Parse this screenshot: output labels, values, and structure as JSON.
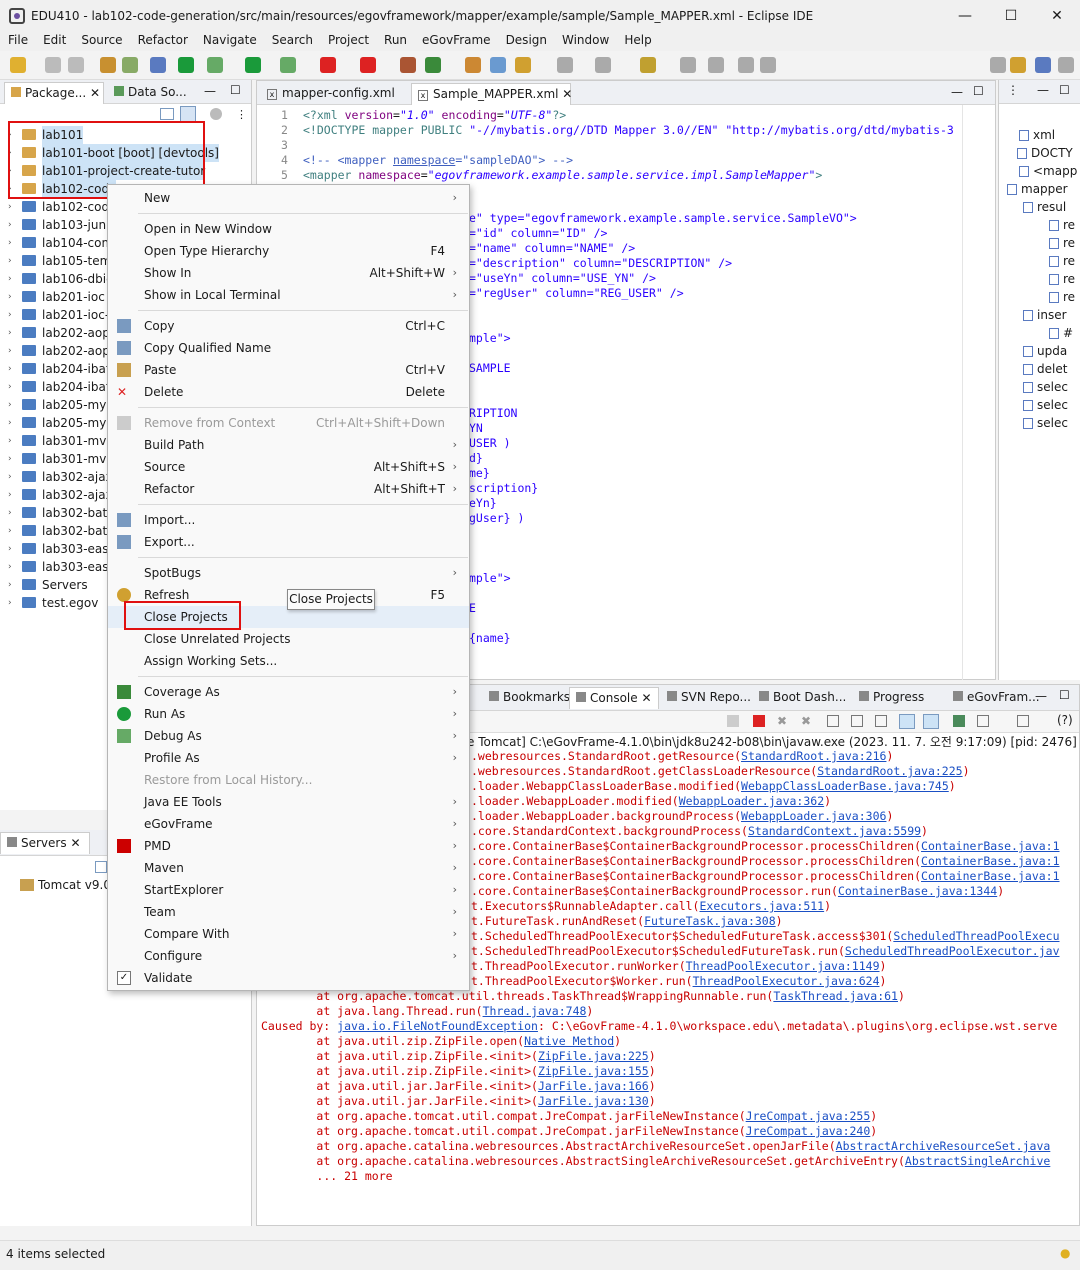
{
  "window": {
    "title": "EDU410 - lab102-code-generation/src/main/resources/egovframework/mapper/example/sample/Sample_MAPPER.xml - Eclipse IDE",
    "minimize": "—",
    "maximize": "☐",
    "close": "✕"
  },
  "menubar": [
    "File",
    "Edit",
    "Source",
    "Refactor",
    "Navigate",
    "Search",
    "Project",
    "Run",
    "eGovFrame",
    "Design",
    "Window",
    "Help"
  ],
  "left_panel": {
    "tabs": [
      "Package...",
      "Data So..."
    ],
    "tree": [
      {
        "label": "lab101",
        "selected": true
      },
      {
        "label": "lab101-boot [boot] [devtools]",
        "selected": true
      },
      {
        "label": "lab101-project-create-tutor",
        "selected": true
      },
      {
        "label": "lab102-code",
        "selected": true
      },
      {
        "label": "lab102-code"
      },
      {
        "label": "lab103-junit"
      },
      {
        "label": "lab104-com"
      },
      {
        "label": "lab105-tem"
      },
      {
        "label": "lab106-dbic"
      },
      {
        "label": "lab201-ioc"
      },
      {
        "label": "lab201-ioc-"
      },
      {
        "label": "lab202-aop"
      },
      {
        "label": "lab202-aop-"
      },
      {
        "label": "lab204-ibati"
      },
      {
        "label": "lab204-ibati"
      },
      {
        "label": "lab205-myb"
      },
      {
        "label": "lab205-myb"
      },
      {
        "label": "lab301-mvc"
      },
      {
        "label": "lab301-mvc"
      },
      {
        "label": "lab302-ajax"
      },
      {
        "label": "lab302-ajax"
      },
      {
        "label": "lab302-batc"
      },
      {
        "label": "lab302-batc"
      },
      {
        "label": "lab303-easy"
      },
      {
        "label": "lab303-easy"
      },
      {
        "label": "Servers"
      },
      {
        "label": "test.egov"
      }
    ]
  },
  "servers_panel": {
    "tab": "Servers",
    "item": "Tomcat v9.0"
  },
  "editor": {
    "tabs": [
      "mapper-config.xml",
      "Sample_MAPPER.xml"
    ],
    "lines": [
      {
        "n": "1",
        "html": "<span class='tag'>&lt;?xml</span> <span class='attr'>version</span>=<span class='str'>\"1.0\"</span> <span class='attr'>encoding</span>=<span class='str'>\"UTF-8\"</span><span class='tag'>?&gt;</span>"
      },
      {
        "n": "2",
        "html": "<span class='tag'>&lt;!DOCTYPE mapper PUBLIC</span> <span class='str' style='font-style:normal'>\"-//mybatis.org//DTD Mapper 3.0//EN\" \"http://mybatis.org/dtd/mybatis-3</span>"
      },
      {
        "n": "3",
        "html": ""
      },
      {
        "n": "4",
        "html": "<span class='cmt'>&lt;!-- &lt;mapper <u>namespace</u>=\"sampleDAO\"&gt; --&gt;</span>"
      },
      {
        "n": "5",
        "html": "<span class='tag'>&lt;mapper</span> <span class='attr'>namespace</span>=<span class='str'>\"egovframework.example.sample.service.impl.SampleMapper\"</span><span class='tag'>&gt;</span>"
      }
    ],
    "partial_lines": [
      "e\" type=\"egovframework.example.sample.service.SampleVO\">",
      "=\"id\" column=\"ID\" />",
      "=\"name\" column=\"NAME\" />",
      "=\"description\" column=\"DESCRIPTION\" />",
      "=\"useYn\" column=\"USE_YN\" />",
      "=\"regUser\" column=\"REG_USER\" />",
      "",
      "",
      "mple\">",
      "",
      "SAMPLE",
      "",
      "",
      "RIPTION",
      "YN",
      "USER )",
      "d}",
      "me}",
      "scription}",
      "eYn}",
      "gUser} )",
      "",
      "",
      "",
      "mple\">",
      "",
      "E",
      "",
      "{name}"
    ]
  },
  "outline": {
    "items": [
      "xml",
      "DOCTY",
      "<mapp",
      "mapper",
      "resul",
      "re",
      "re",
      "re",
      "re",
      "re",
      "inser",
      "#",
      "upda",
      "delet",
      "selec",
      "selec",
      "selec"
    ]
  },
  "console": {
    "tabs": [
      "Bookmarks",
      "Console",
      "SVN Repo...",
      "Boot Dash...",
      "Progress",
      "eGovFram..."
    ],
    "header": "e Tomcat] C:\\eGovFrame-4.1.0\\bin\\jdk8u242-b08\\bin\\javaw.exe  (2023. 11. 7. 오전 9:17:09) [pid: 2476]",
    "lines": [
      [
        "",
        ".webresources.StandardRoot.getResource(",
        "StandardRoot.java:216",
        ")"
      ],
      [
        "",
        ".webresources.StandardRoot.getClassLoaderResource(",
        "StandardRoot.java:225",
        ")"
      ],
      [
        "",
        ".loader.WebappClassLoaderBase.modified(",
        "WebappClassLoaderBase.java:745",
        ")"
      ],
      [
        "",
        ".loader.WebappLoader.modified(",
        "WebappLoader.java:362",
        ")"
      ],
      [
        "",
        ".loader.WebappLoader.backgroundProcess(",
        "WebappLoader.java:306",
        ")"
      ],
      [
        "",
        ".core.StandardContext.backgroundProcess(",
        "StandardContext.java:5599",
        ")"
      ],
      [
        "",
        ".core.ContainerBase$ContainerBackgroundProcessor.processChildren(",
        "ContainerBase.java:1",
        ""
      ],
      [
        "",
        ".core.ContainerBase$ContainerBackgroundProcessor.processChildren(",
        "ContainerBase.java:1",
        ""
      ],
      [
        "",
        ".core.ContainerBase$ContainerBackgroundProcessor.processChildren(",
        "ContainerBase.java:1",
        ""
      ],
      [
        "",
        ".core.ContainerBase$ContainerBackgroundProcessor.run(",
        "ContainerBase.java:1344",
        ")"
      ],
      [
        "",
        "t.Executors$RunnableAdapter.call(",
        "Executors.java:511",
        ")"
      ],
      [
        "",
        "t.FutureTask.runAndReset(",
        "FutureTask.java:308",
        ")"
      ],
      [
        "",
        "t.ScheduledThreadPoolExecutor$ScheduledFutureTask.access$301(",
        "ScheduledThreadPoolExecu",
        ""
      ],
      [
        "",
        "t.ScheduledThreadPoolExecutor$ScheduledFutureTask.run(",
        "ScheduledThreadPoolExecutor.jav",
        ""
      ],
      [
        "",
        "t.ThreadPoolExecutor.runWorker(",
        "ThreadPoolExecutor.java:1149",
        ")"
      ],
      [
        "",
        "t.ThreadPoolExecutor$Worker.run(",
        "ThreadPoolExecutor.java:624",
        ")"
      ],
      [
        "        ",
        "at org.apache.tomcat.util.threads.TaskThread$WrappingRunnable.run(",
        "TaskThread.java:61",
        ")"
      ],
      [
        "        ",
        "at java.lang.Thread.run(",
        "Thread.java:748",
        ")"
      ],
      [
        "",
        "Caused by: ",
        "java.io.FileNotFoundException",
        ": C:\\eGovFrame-4.1.0\\workspace.edu\\.metadata\\.plugins\\org.eclipse.wst.serve"
      ],
      [
        "        ",
        "at java.util.zip.ZipFile.open(",
        "Native Method",
        ")"
      ],
      [
        "        ",
        "at java.util.zip.ZipFile.<init>(",
        "ZipFile.java:225",
        ")"
      ],
      [
        "        ",
        "at java.util.zip.ZipFile.<init>(",
        "ZipFile.java:155",
        ")"
      ],
      [
        "        ",
        "at java.util.jar.JarFile.<init>(",
        "JarFile.java:166",
        ")"
      ],
      [
        "        ",
        "at java.util.jar.JarFile.<init>(",
        "JarFile.java:130",
        ")"
      ],
      [
        "        ",
        "at org.apache.tomcat.util.compat.JreCompat.jarFileNewInstance(",
        "JreCompat.java:255",
        ")"
      ],
      [
        "        ",
        "at org.apache.tomcat.util.compat.JreCompat.jarFileNewInstance(",
        "JreCompat.java:240",
        ")"
      ],
      [
        "        ",
        "at org.apache.catalina.webresources.AbstractArchiveResourceSet.openJarFile(",
        "AbstractArchiveResourceSet.java",
        ""
      ],
      [
        "        ",
        "at org.apache.catalina.webresources.AbstractSingleArchiveResourceSet.getArchiveEntry(",
        "AbstractSingleArchive",
        ""
      ],
      [
        "        ",
        "... 21 more",
        "",
        ""
      ]
    ]
  },
  "context_menu": {
    "items": [
      {
        "label": "New",
        "shortcut": "",
        "arrow": true,
        "icon": ""
      },
      {
        "sep": true
      },
      {
        "label": "Open in New Window",
        "shortcut": "",
        "arrow": false
      },
      {
        "label": "Open Type Hierarchy",
        "shortcut": "F4",
        "arrow": false
      },
      {
        "label": "Show In",
        "shortcut": "Alt+Shift+W",
        "arrow": true
      },
      {
        "label": "Show in Local Terminal",
        "shortcut": "",
        "arrow": true
      },
      {
        "sep": true
      },
      {
        "label": "Copy",
        "shortcut": "Ctrl+C",
        "icon": "copy-icon"
      },
      {
        "label": "Copy Qualified Name",
        "shortcut": "",
        "icon": "copy-qualified-icon"
      },
      {
        "label": "Paste",
        "shortcut": "Ctrl+V",
        "icon": "paste-icon"
      },
      {
        "label": "Delete",
        "shortcut": "Delete",
        "icon": "delete-icon"
      },
      {
        "sep": true
      },
      {
        "label": "Remove from Context",
        "shortcut": "Ctrl+Alt+Shift+Down",
        "disabled": true,
        "icon": "remove-context-icon"
      },
      {
        "label": "Build Path",
        "shortcut": "",
        "arrow": true
      },
      {
        "label": "Source",
        "shortcut": "Alt+Shift+S",
        "arrow": true
      },
      {
        "label": "Refactor",
        "shortcut": "Alt+Shift+T",
        "arrow": true
      },
      {
        "sep": true
      },
      {
        "label": "Import...",
        "shortcut": "",
        "icon": "import-icon"
      },
      {
        "label": "Export...",
        "shortcut": "",
        "icon": "export-icon"
      },
      {
        "sep": true
      },
      {
        "label": "SpotBugs",
        "shortcut": "",
        "arrow": true
      },
      {
        "label": "Refresh",
        "shortcut": "F5",
        "icon": "refresh-icon"
      },
      {
        "label": "Close Projects",
        "shortcut": "",
        "highlight": true
      },
      {
        "label": "Close Unrelated Projects",
        "shortcut": ""
      },
      {
        "label": "Assign Working Sets...",
        "shortcut": ""
      },
      {
        "sep": true
      },
      {
        "label": "Coverage As",
        "shortcut": "",
        "arrow": true,
        "icon": "coverage-icon"
      },
      {
        "label": "Run As",
        "shortcut": "",
        "arrow": true,
        "icon": "run-icon"
      },
      {
        "label": "Debug As",
        "shortcut": "",
        "arrow": true,
        "icon": "debug-icon"
      },
      {
        "label": "Profile As",
        "shortcut": "",
        "arrow": true
      },
      {
        "label": "Restore from Local History...",
        "shortcut": "",
        "disabled": true
      },
      {
        "label": "Java EE Tools",
        "shortcut": "",
        "arrow": true
      },
      {
        "label": "eGovFrame",
        "shortcut": "",
        "arrow": true
      },
      {
        "label": "PMD",
        "shortcut": "",
        "arrow": true,
        "icon": "pmd-icon"
      },
      {
        "label": "Maven",
        "shortcut": "",
        "arrow": true
      },
      {
        "label": "StartExplorer",
        "shortcut": "",
        "arrow": true
      },
      {
        "label": "Team",
        "shortcut": "",
        "arrow": true
      },
      {
        "label": "Compare With",
        "shortcut": "",
        "arrow": true
      },
      {
        "label": "Configure",
        "shortcut": "",
        "arrow": true
      },
      {
        "label": "Validate",
        "shortcut": "",
        "icon": "validate-icon"
      }
    ]
  },
  "tooltip": "Close Projects",
  "status": "4 items selected",
  "colors": {
    "highlight_box": "#e01010",
    "selection": "#cde3f6",
    "error_text": "#c80000",
    "link": "#1a4fc4"
  }
}
